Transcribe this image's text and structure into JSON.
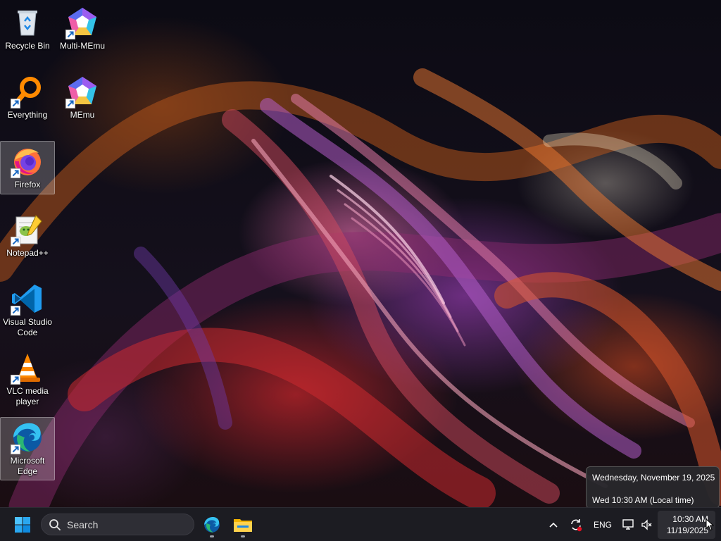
{
  "desktop": {
    "icons": [
      {
        "label": "Recycle Bin",
        "icon": "recycle-bin-icon",
        "shortcut": false,
        "selected": false
      },
      {
        "label": "Multi-MEmu",
        "icon": "multi-memu-icon",
        "shortcut": true,
        "selected": false
      },
      {
        "label": "Everything",
        "icon": "everything-search-icon",
        "shortcut": true,
        "selected": false
      },
      {
        "label": "MEmu",
        "icon": "memu-icon",
        "shortcut": true,
        "selected": false
      },
      {
        "label": "Firefox",
        "icon": "firefox-icon",
        "shortcut": true,
        "selected": true
      },
      {
        "label": "Notepad++",
        "icon": "notepad-plus-plus-icon",
        "shortcut": true,
        "selected": false
      },
      {
        "label": "Visual Studio Code",
        "icon": "vscode-icon",
        "shortcut": true,
        "selected": false
      },
      {
        "label": "VLC media player",
        "icon": "vlc-icon",
        "shortcut": true,
        "selected": false
      },
      {
        "label": "Microsoft Edge",
        "icon": "edge-icon",
        "shortcut": true,
        "selected": true
      }
    ]
  },
  "tooltip": {
    "date_line": "Wednesday, November 19, 2025",
    "time_line": "Wed 10:30 AM (Local time)"
  },
  "taskbar": {
    "start_icon": "windows-start-icon",
    "search_placeholder": "Search",
    "search_icon": "search-icon",
    "pinned": [
      {
        "name": "Microsoft Edge",
        "icon": "edge-icon",
        "running": true
      },
      {
        "name": "File Explorer",
        "icon": "folder-icon",
        "running": true
      }
    ],
    "tray": {
      "chevron_icon": "chevron-up-icon",
      "sync_icon": "sync-alert-icon",
      "language": "ENG",
      "network_icon": "network-icon",
      "volume_icon": "volume-muted-icon",
      "time": "10:30 AM",
      "date": "11/19/2025"
    }
  },
  "colors": {
    "taskbar_bg": "#1c1c22",
    "accent": "#0078d4",
    "tooltip_bg": "#28282c"
  }
}
